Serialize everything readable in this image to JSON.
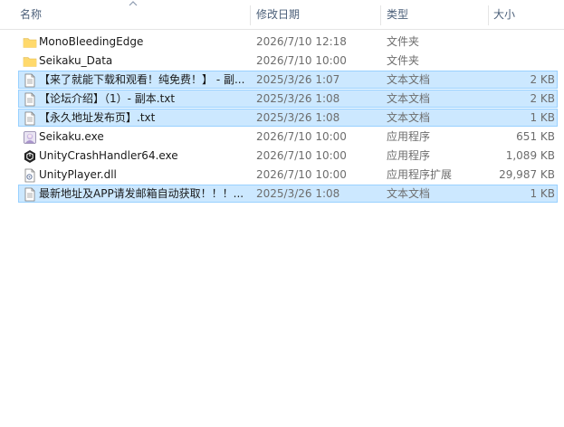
{
  "columns": {
    "name": "名称",
    "date": "修改日期",
    "type": "类型",
    "size": "大小"
  },
  "files": [
    {
      "name": "MonoBleedingEdge",
      "date": "2026/7/10 12:18",
      "type": "文件夹",
      "size": "",
      "icon": "folder-icon",
      "selected": false
    },
    {
      "name": "Seikaku_Data",
      "date": "2026/7/10 10:00",
      "type": "文件夹",
      "size": "",
      "icon": "folder-icon",
      "selected": false
    },
    {
      "name": "【来了就能下载和观看！纯免费！】 - 副...",
      "date": "2025/3/26 1:07",
      "type": "文本文档",
      "size": "2 KB",
      "icon": "text-file-icon",
      "selected": true
    },
    {
      "name": "【论坛介绍】（1）- 副本.txt",
      "date": "2025/3/26 1:08",
      "type": "文本文档",
      "size": "2 KB",
      "icon": "text-file-icon",
      "selected": true
    },
    {
      "name": "【永久地址发布页】.txt",
      "date": "2025/3/26 1:08",
      "type": "文本文档",
      "size": "1 KB",
      "icon": "text-file-icon",
      "selected": true
    },
    {
      "name": "Seikaku.exe",
      "date": "2026/7/10 10:00",
      "type": "应用程序",
      "size": "651 KB",
      "icon": "app-exe-icon",
      "selected": false
    },
    {
      "name": "UnityCrashHandler64.exe",
      "date": "2026/7/10 10:00",
      "type": "应用程序",
      "size": "1,089 KB",
      "icon": "unity-exe-icon",
      "selected": false
    },
    {
      "name": "UnityPlayer.dll",
      "date": "2026/7/10 10:00",
      "type": "应用程序扩展",
      "size": "29,987 KB",
      "icon": "dll-file-icon",
      "selected": false
    },
    {
      "name": "最新地址及APP请发邮箱自动获取！！！...",
      "date": "2025/3/26 1:08",
      "type": "文本文档",
      "size": "1 KB",
      "icon": "text-file-icon",
      "selected": true
    }
  ],
  "colors": {
    "selection_bg": "#cce8ff",
    "selection_border": "#99d1ff",
    "header_text": "#4c607a",
    "meta_text": "#6d6d6d",
    "folder": "#f8d775"
  }
}
